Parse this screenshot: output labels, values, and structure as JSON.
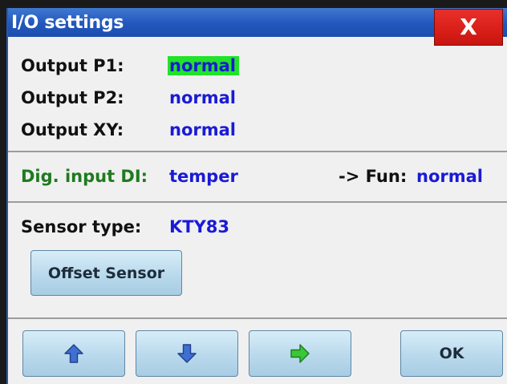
{
  "window": {
    "title": "I/O settings",
    "close_label": "X"
  },
  "outputs": [
    {
      "label": "Output P1:",
      "value": "normal",
      "highlighted": true
    },
    {
      "label": "Output P2:",
      "value": "normal",
      "highlighted": false
    },
    {
      "label": "Output XY:",
      "value": "normal",
      "highlighted": false
    }
  ],
  "digital_input": {
    "label": "Dig. input DI:",
    "value": "temper",
    "fun_label": "-> Fun:",
    "fun_value": "normal"
  },
  "sensor": {
    "label": "Sensor type:",
    "value": "KTY83"
  },
  "buttons": {
    "offset_sensor": "Offset Sensor",
    "ok": "OK"
  },
  "icons": {
    "up": "arrow-up-icon",
    "down": "arrow-down-icon",
    "right": "arrow-right-icon"
  },
  "colors": {
    "title_bar": "#2257bd",
    "close_button": "#d91e18",
    "value_text": "#1a1ad6",
    "highlight": "#22e22a",
    "dig_input_label": "#1f7a1f",
    "arrow_up_down": "#3f6fd1",
    "arrow_right": "#38c838"
  }
}
